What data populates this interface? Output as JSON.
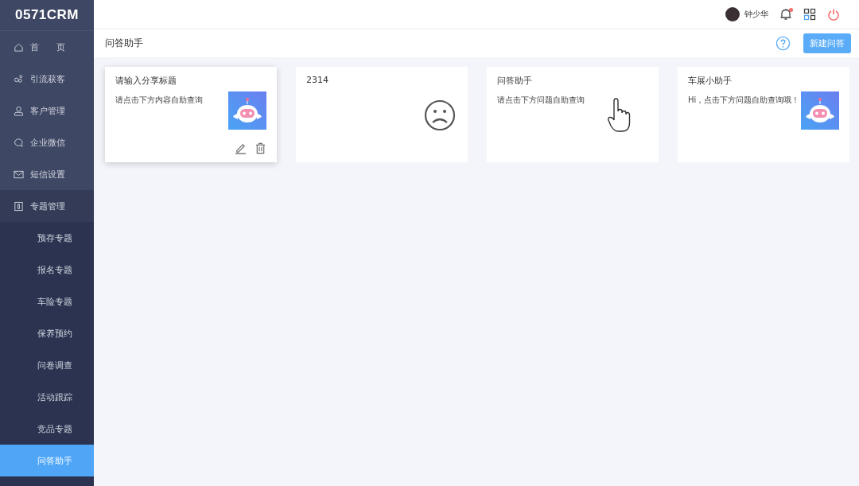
{
  "logo": "0571CRM",
  "sidebar": {
    "items": [
      {
        "kind": "home",
        "label": "首　　页",
        "selected": false
      },
      {
        "kind": "share",
        "label": "引流获客",
        "selected": false
      },
      {
        "kind": "user",
        "label": "客户管理",
        "selected": false
      },
      {
        "kind": "chat",
        "label": "企业微信",
        "selected": false
      },
      {
        "kind": "mail",
        "label": "短信设置",
        "selected": false
      },
      {
        "kind": "book",
        "label": "专题管理",
        "selected": false,
        "expanded": true,
        "children": [
          {
            "label": "预存专题",
            "selected": false
          },
          {
            "label": "报名专题",
            "selected": false
          },
          {
            "label": "车险专题",
            "selected": false
          },
          {
            "label": "保养预约",
            "selected": false
          },
          {
            "label": "问卷调查",
            "selected": false
          },
          {
            "label": "活动跟踪",
            "selected": false
          },
          {
            "label": "竞品专题",
            "selected": false
          },
          {
            "label": "问答助手",
            "selected": true
          }
        ]
      }
    ]
  },
  "header": {
    "user_name": "钟少华",
    "has_notification": true
  },
  "page": {
    "title": "问答助手",
    "new_button": "新建问答"
  },
  "cards": [
    {
      "title": "请输入分享标题",
      "text": "请点击下方内容自助查询",
      "kind": "robot",
      "hovered": true
    },
    {
      "title": "2314",
      "kind": "sad"
    },
    {
      "title": "问答助手",
      "text": "请点击下方问题自助查询",
      "kind": "pointer",
      "hovered": false
    },
    {
      "title": "车展小助手",
      "text": "Hi，点击下方问题自助查询哦！",
      "kind": "robot",
      "hovered": false
    }
  ]
}
